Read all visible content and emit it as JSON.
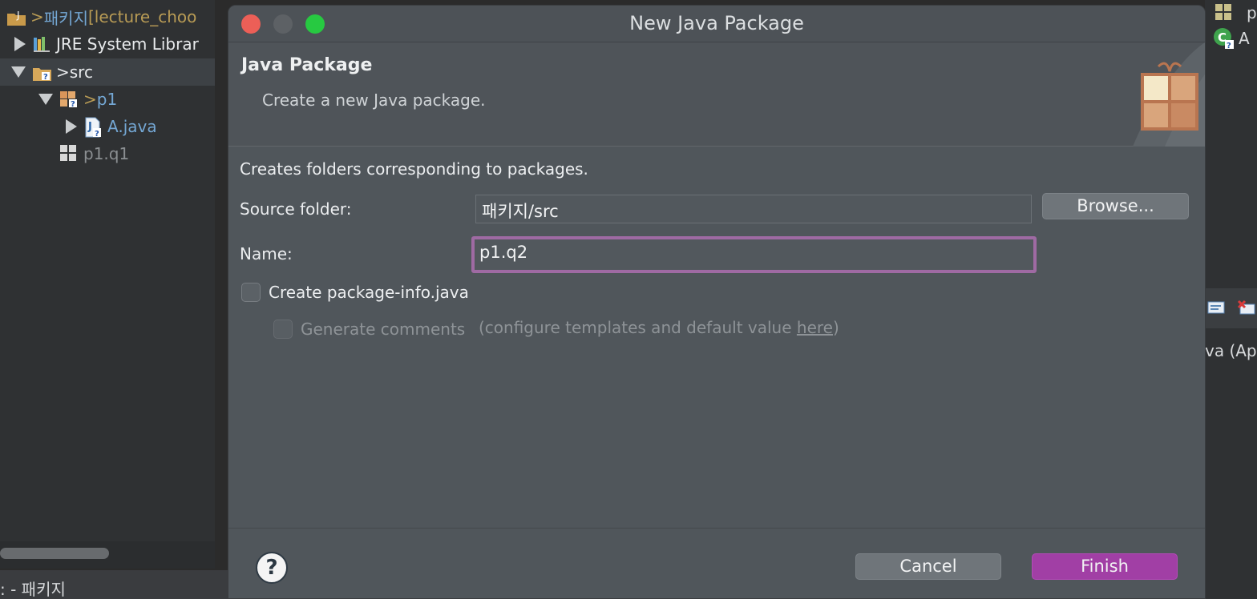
{
  "explorer": {
    "rows": [
      {
        "prefix": "> ",
        "label": "패키지",
        "suffix": " [lecture_choo"
      },
      {
        "label": "JRE System Librar"
      },
      {
        "prefix": "> ",
        "label": "src"
      },
      {
        "prefix": "> ",
        "label": "p1"
      },
      {
        "label": "A.java"
      },
      {
        "label": "p1.q1"
      }
    ]
  },
  "statusbar": {
    "text": ": - 패키지"
  },
  "rightstrip": {
    "top_label": "p",
    "class_label": "A",
    "editor_label": "va  (Ap"
  },
  "dialog": {
    "title": "New Java Package",
    "banner": {
      "title": "Java Package",
      "description": "Create a new Java package."
    },
    "intro": "Creates folders corresponding to packages.",
    "source_folder": {
      "label": "Source folder:",
      "value": "패키지/src",
      "browse_label": "Browse..."
    },
    "name": {
      "label": "Name:",
      "value": "p1.q2"
    },
    "create_package_info": {
      "label": "Create package-info.java",
      "checked": false
    },
    "generate_comments": {
      "label": "Generate comments",
      "hint_prefix": "(configure templates and default value ",
      "hint_link": "here",
      "hint_suffix": ")",
      "checked": false,
      "enabled": false
    },
    "buttons": {
      "help": "?",
      "cancel": "Cancel",
      "finish": "Finish"
    }
  },
  "colors": {
    "accent": "#a13fa5",
    "focus_ring": "#9f6aa3",
    "close": "#ec5f57",
    "minimize": "#5d6165",
    "maximize": "#27c941"
  }
}
